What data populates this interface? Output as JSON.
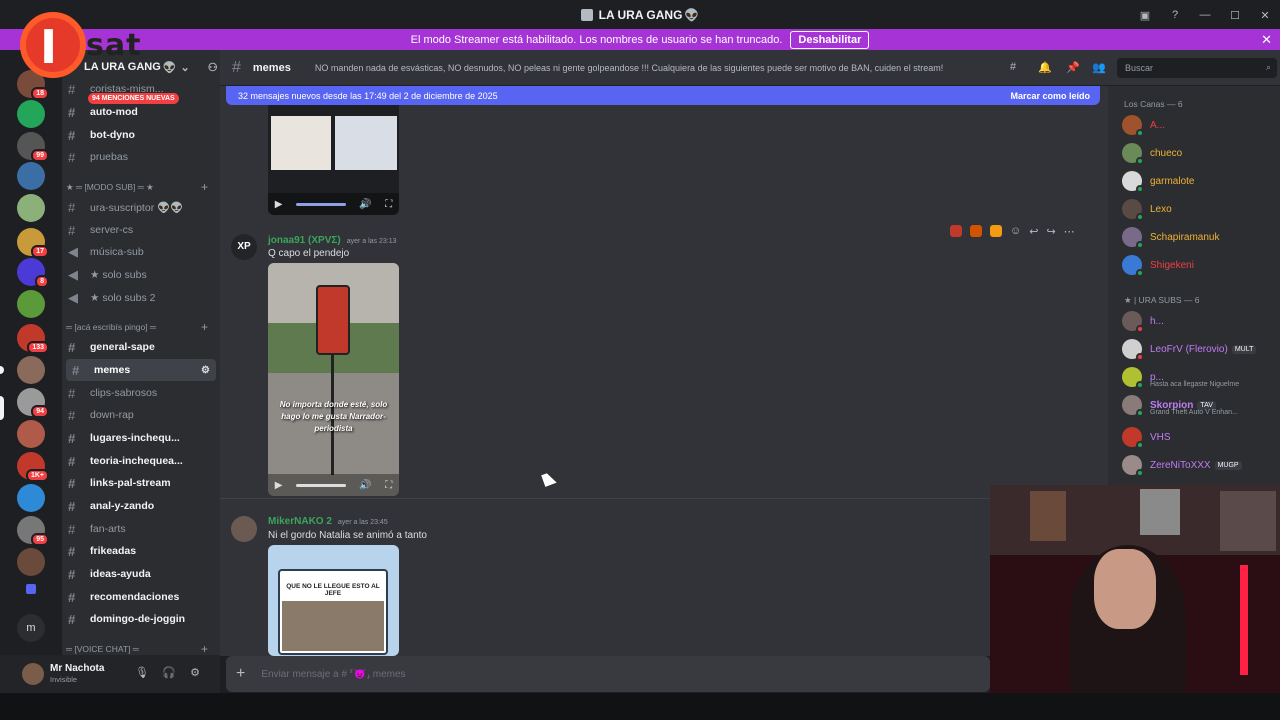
{
  "window": {
    "title": "LA URA GANG",
    "title_suffix": "👽"
  },
  "streamer": {
    "text": "El modo Streamer está habilitado. Los nombres de usuario se han truncado.",
    "button": "Deshabilitar"
  },
  "logo": {
    "letter": "I",
    "word": "sat"
  },
  "servers": {
    "badges": [
      "18",
      "99",
      "17",
      "8",
      "133",
      "94",
      "1K+",
      "95"
    ]
  },
  "guild": {
    "name": "LA URA GANG",
    "suffix": "👽",
    "mention_badge": "94 MENCIONES NUEVAS"
  },
  "channels": {
    "top": [
      "coristas-mism...",
      "auto-mod",
      "bot-dyno",
      "pruebas"
    ],
    "cat_sub": "★ ═ [MODO SUB] ═ ★",
    "sub_items": [
      "ura-suscriptor 👽👽",
      "server-cs",
      "música-sub",
      "★ solo subs",
      "★ solo subs 2"
    ],
    "cat_aca": "═ [acá escribís pingo] ═",
    "aca_items": [
      "general-sape",
      "memes",
      "clips-sabrosos",
      "down-rap",
      "lugares-inchequ...",
      "teoria-inchequea...",
      "links-pal-stream",
      "anal-y-zando",
      "fan-arts",
      "frikeadas",
      "ideas-ayuda",
      "recomendaciones",
      "domingo-de-joggin"
    ],
    "cat_voice": "═ [VOICE CHAT] ═"
  },
  "user": {
    "name": "Mr Nachota",
    "status": "Invisible"
  },
  "header": {
    "channel": "memes",
    "topic": "NO manden nada de esvásticas, NO desnudos, NO peleas ni gente golpeandose !!! Cualquiera de las siguientes puede ser motivo de BAN, cuiden el stream!",
    "search_placeholder": "Buscar"
  },
  "newbar": {
    "text": "32 mensajes nuevos desde las 17:49 del 2 de diciembre de 2025",
    "mark": "Marcar como leído"
  },
  "messages": [
    {
      "author": "jonaa91 (XPVΣ)",
      "time": "ayer a las 23:13",
      "text": "Q capo el pendejo",
      "caption": "No importa donde esté, solo hago lo me gusta Narrador-periodista",
      "avatar_initials": "XP"
    },
    {
      "author": "MikerNAKO 2",
      "time": "ayer a las 23:45",
      "text": "Ni  el gordo Natalia se animó a tanto",
      "thumb_caption": "QUE NO LE LLEGUE ESTO AL JEFE"
    }
  ],
  "members": {
    "cat1": "Los Canas — 6",
    "group1": [
      {
        "name": "A...",
        "color": "#f23f42"
      },
      {
        "name": "chueco",
        "color": "#f0b232"
      },
      {
        "name": "garmalote",
        "color": "#f0b232"
      },
      {
        "name": "Lexo",
        "color": "#f0b232"
      },
      {
        "name": "Schapiramanuk",
        "color": "#f0b232"
      },
      {
        "name": "Shigekeni",
        "color": "#f23f42"
      }
    ],
    "cat2": "★ | URA SUBS — 6",
    "group2": [
      {
        "name": "h...",
        "color": "#c27cf5",
        "tag": "",
        "sub": ""
      },
      {
        "name": "LeoFrV (Flerovio)",
        "color": "#c27cf5",
        "tag": "MULT",
        "sub": ""
      },
      {
        "name": "p...",
        "color": "#c27cf5",
        "tag": "",
        "sub": "Hasta aca llegaste Niguelme"
      },
      {
        "name": "Skorpion",
        "color": "#c27cf5",
        "tag": "TAV",
        "sub": "Grand Theft Auto V Enhan..."
      },
      {
        "name": "VHS",
        "color": "#c27cf5",
        "tag": "",
        "sub": ""
      },
      {
        "name": "ZereNiToXXX",
        "color": "#c27cf5",
        "tag": "MUGP",
        "sub": ""
      }
    ]
  },
  "composer": {
    "placeholder": "Enviar mensaje a #  ⸢😈⸥ memes"
  },
  "colors": {
    "accent": "#5865f2",
    "streamer": "#a633d6",
    "bg_chat": "#313338"
  }
}
